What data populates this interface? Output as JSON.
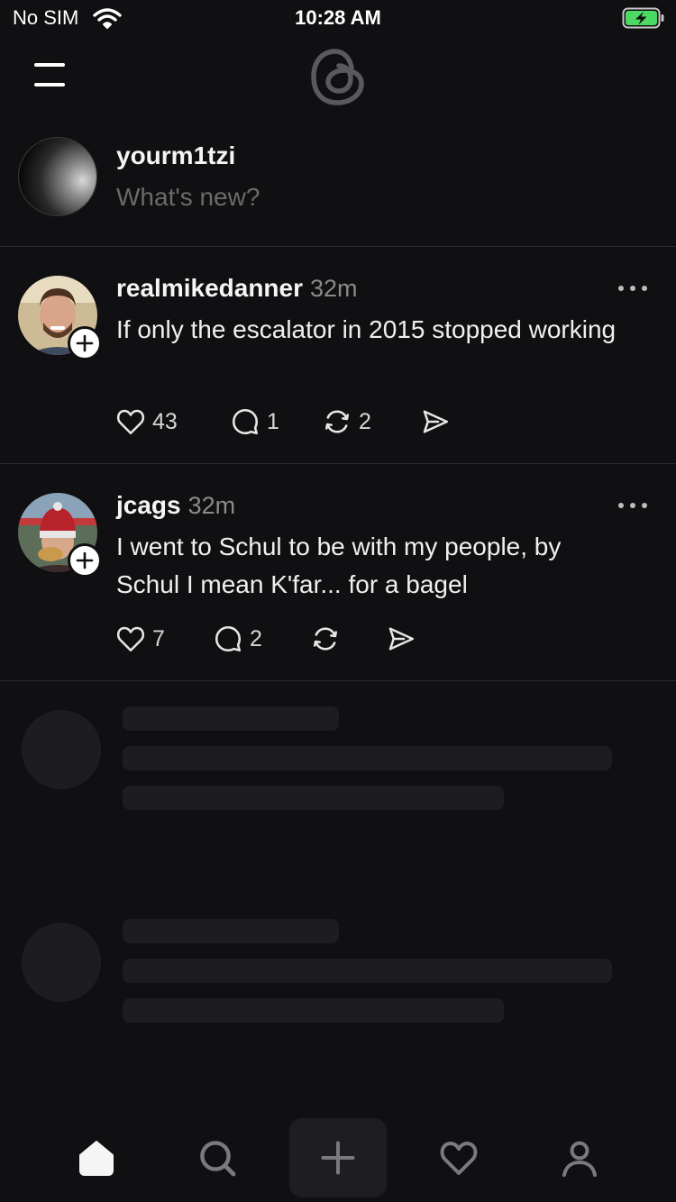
{
  "status_bar": {
    "carrier": "No SIM",
    "time": "10:28 AM",
    "battery_color": "#4cd964"
  },
  "header": {
    "menu_icon": "hamburger-menu-icon",
    "logo_icon": "threads-logo-icon"
  },
  "composer": {
    "username": "yourm1tzi",
    "placeholder": "What's new?"
  },
  "posts": [
    {
      "username": "realmikedanner",
      "time": "32m",
      "text": "If only the escalator in 2015 stopped working",
      "likes": "43",
      "replies": "1",
      "reposts": "2"
    },
    {
      "username": "jcags",
      "time": "32m",
      "text": "I went to Schul to be with my people, by Schul I mean K'far... for a bagel",
      "likes": "7",
      "replies": "2",
      "reposts": ""
    }
  ],
  "tab_bar": {
    "items": [
      "home-icon",
      "search-icon",
      "compose-plus-icon",
      "heart-icon",
      "profile-icon"
    ]
  }
}
